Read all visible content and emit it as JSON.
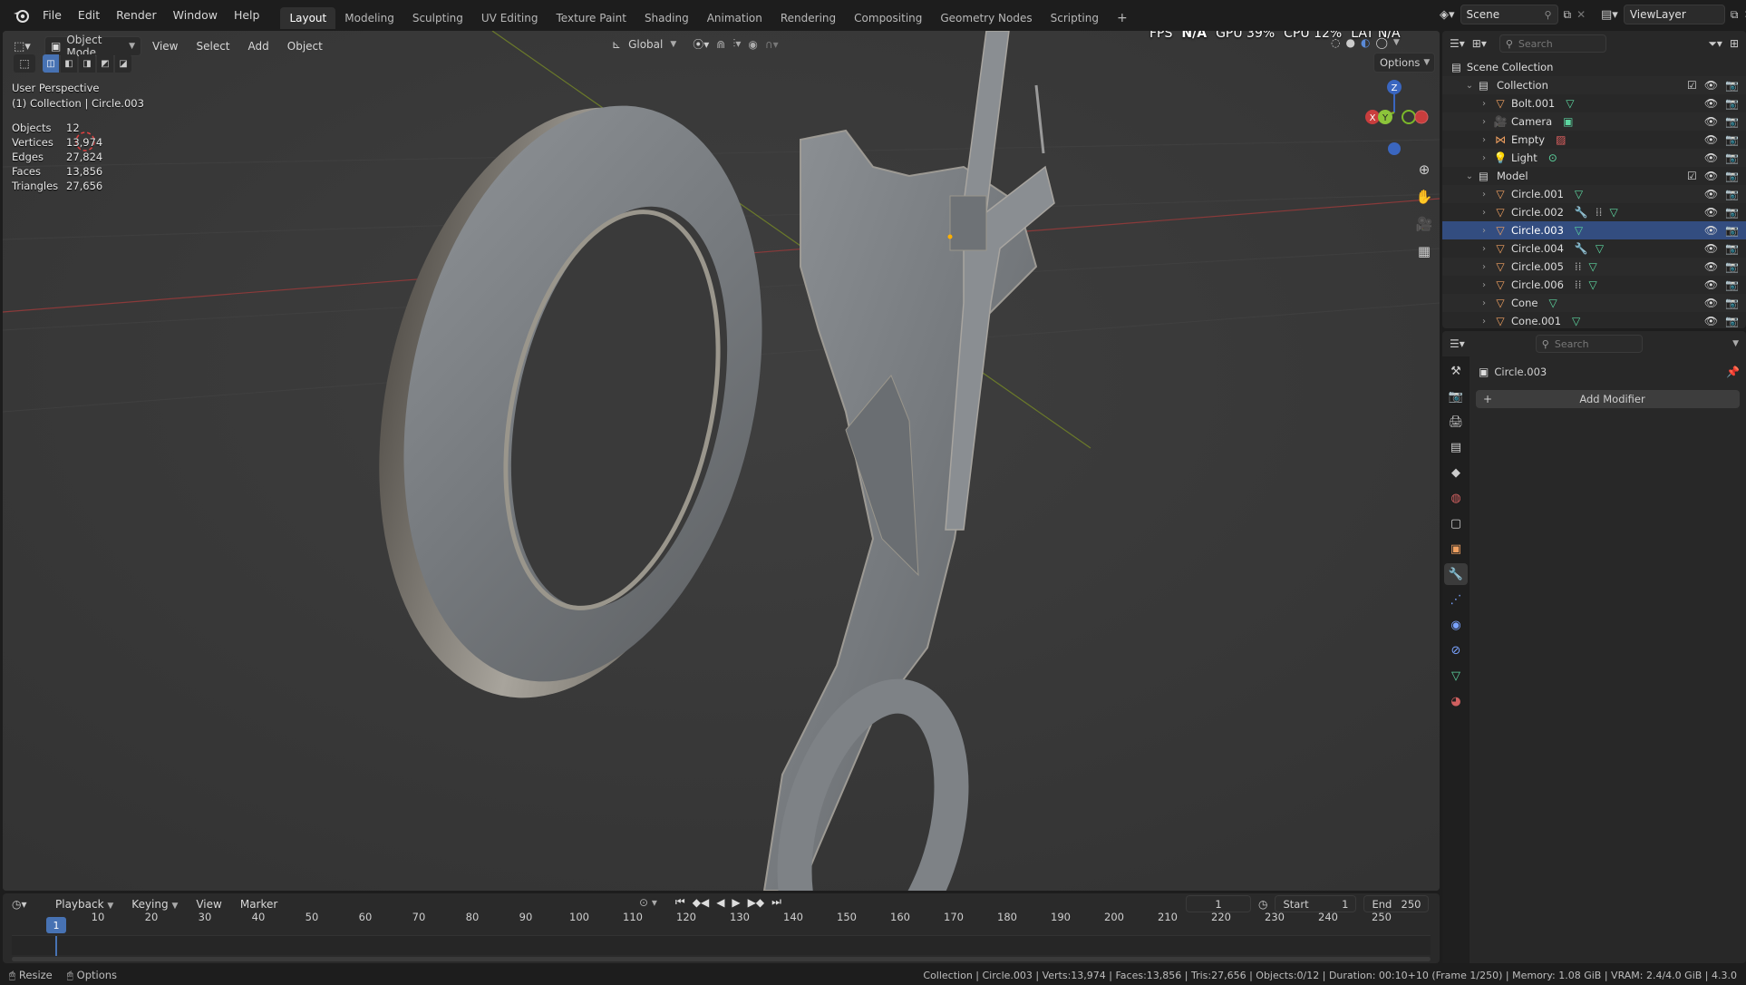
{
  "menu": [
    "File",
    "Edit",
    "Render",
    "Window",
    "Help"
  ],
  "workspaces": [
    "Layout",
    "Modeling",
    "Sculpting",
    "UV Editing",
    "Texture Paint",
    "Shading",
    "Animation",
    "Rendering",
    "Compositing",
    "Geometry Nodes",
    "Scripting"
  ],
  "active_workspace": "Layout",
  "scene_name": "Scene",
  "view_layer": "ViewLayer",
  "viewport": {
    "mode": "Object Mode",
    "header_menus": [
      "View",
      "Select",
      "Add",
      "Object"
    ],
    "transform_orientation": "Global",
    "options_label": "Options",
    "perf": {
      "fps_label": "FPS",
      "fps": "N/A",
      "gpu": "GPU 39%",
      "cpu": "CPU 12%",
      "lat": "LAT N/A"
    },
    "perspective": "User Perspective",
    "context": "(1) Collection | Circle.003",
    "stats": [
      {
        "label": "Objects",
        "value": "12"
      },
      {
        "label": "Vertices",
        "value": "13,974"
      },
      {
        "label": "Edges",
        "value": "27,824"
      },
      {
        "label": "Faces",
        "value": "13,856"
      },
      {
        "label": "Triangles",
        "value": "27,656"
      }
    ],
    "gizmo": {
      "x": "X",
      "y": "Y",
      "z": "Z"
    }
  },
  "outliner": {
    "search_placeholder": "Search",
    "scene_collection": "Scene Collection",
    "collection": "Collection",
    "collection_items": [
      "Bolt.001",
      "Camera",
      "Empty",
      "Light"
    ],
    "model": "Model",
    "model_items": [
      "Circle.001",
      "Circle.002",
      "Circle.003",
      "Circle.004",
      "Circle.005",
      "Circle.006",
      "Cone",
      "Cone.001"
    ],
    "selected": "Circle.003"
  },
  "properties": {
    "search_placeholder": "Search",
    "object_name": "Circle.003",
    "add_modifier": "Add Modifier"
  },
  "timeline": {
    "menus": [
      "Playback",
      "Keying",
      "View",
      "Marker"
    ],
    "current_frame": "1",
    "start_label": "Start",
    "start": "1",
    "end_label": "End",
    "end": "250",
    "ticks": [
      "1",
      "10",
      "20",
      "30",
      "40",
      "50",
      "60",
      "70",
      "80",
      "90",
      "100",
      "110",
      "120",
      "130",
      "140",
      "150",
      "160",
      "170",
      "180",
      "190",
      "200",
      "210",
      "220",
      "230",
      "240",
      "250"
    ]
  },
  "status": {
    "left1": "Resize",
    "left2": "Options",
    "right": "Collection | Circle.003 | Verts:13,974 | Faces:13,856 | Tris:27,656 | Objects:0/12 | Duration: 00:10+10 (Frame 1/250) | Memory: 1.08 GiB | VRAM: 2.4/4.0 GiB | 4.3.0"
  },
  "colors": {
    "accent": "#4772b3",
    "selected_row": "#334d80",
    "object_orange": "#f0a060",
    "mesh_green": "#5dd6a0"
  }
}
